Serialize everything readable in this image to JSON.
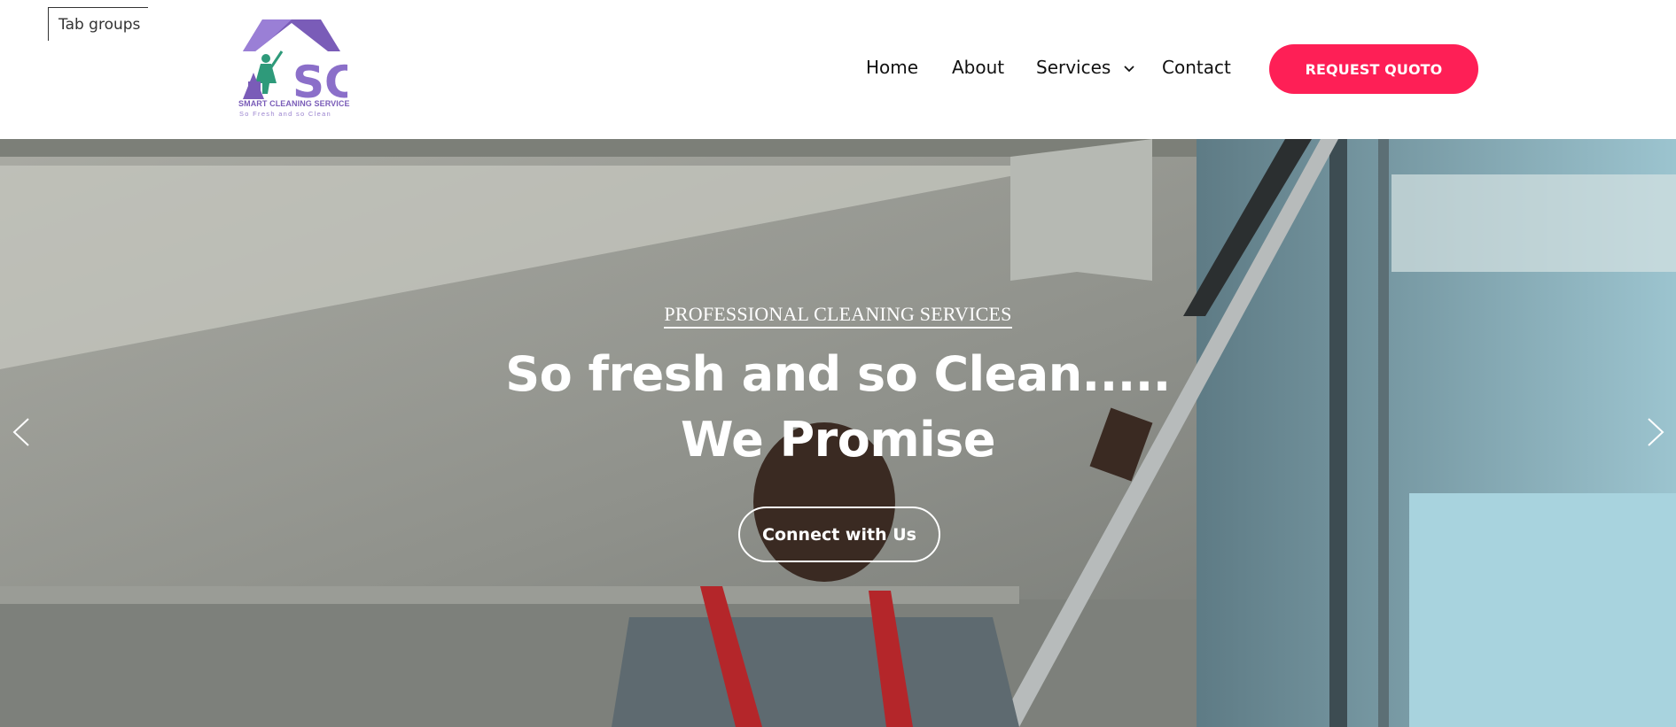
{
  "overlay": {
    "tab_groups": "Tab groups"
  },
  "header": {
    "logo_text": "SMART CLEANING SERVICE",
    "logo_tagline": "So Fresh and so Clean",
    "logo_letters": "SC",
    "nav": [
      {
        "label": "Home"
      },
      {
        "label": "About"
      },
      {
        "label": "Services",
        "icon": "chevron-down-icon"
      },
      {
        "label": "Contact"
      }
    ],
    "cta_label": "REQUEST QUOTO"
  },
  "hero": {
    "kicker": "PROFESSIONAL CLEANING SERVICES",
    "title_line1": "So fresh and so Clean.....",
    "title_line2": "We Promise",
    "button_label": "Connect with Us",
    "prev_icon": "chevron-left-icon",
    "next_icon": "chevron-right-icon"
  },
  "colors": {
    "accent": "#fe1f56",
    "logo_purple": "#7a5cb8",
    "logo_green": "#2e9a7a"
  }
}
